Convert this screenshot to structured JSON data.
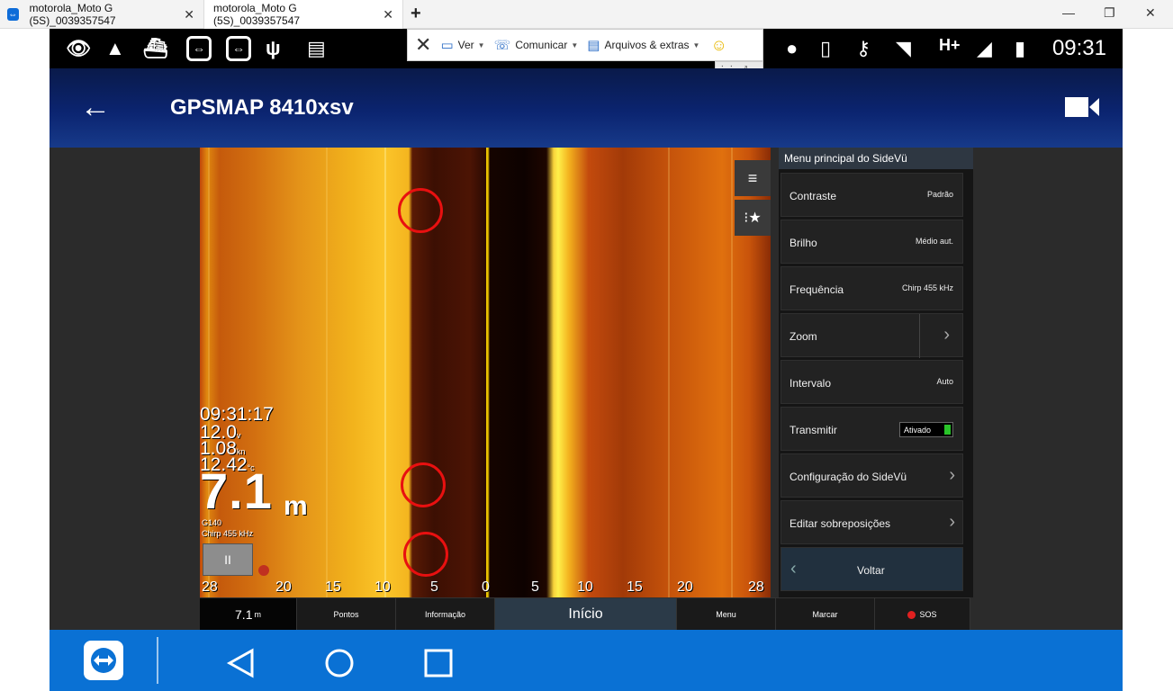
{
  "browser": {
    "tabs": [
      {
        "label": "motorola_Moto G (5S)_0039357547"
      },
      {
        "label": "motorola_Moto G (5S)_0039357547"
      }
    ],
    "new_tab": "+",
    "tab_close": "✕",
    "window_controls": {
      "minimize": "—",
      "maximize": "❐",
      "close": "✕"
    }
  },
  "teamviewer": {
    "close": "✕",
    "ver": "Ver",
    "comunicar": "Comunicar",
    "arquivos": "Arquivos & extras",
    "emoji": "☺"
  },
  "status_bar": {
    "clock": "09:31",
    "network": "H+"
  },
  "app_bar": {
    "title": "GPSMAP 8410xsv"
  },
  "sonar": {
    "time": "09:31:17",
    "voltage": "12.0",
    "voltage_unit": "v",
    "speed": "1.08",
    "speed_unit": "kn",
    "temperature": "12.42",
    "temperature_unit": "°c",
    "depth": "7.1",
    "depth_unit": "m",
    "gain": "G140",
    "frequency": "Chirp 455 kHz",
    "pause": "II",
    "range_ticks": [
      "28",
      "20",
      "15",
      "10",
      "5",
      "0",
      "5",
      "10",
      "15",
      "20",
      "28"
    ]
  },
  "menu": {
    "title": "Menu principal do SideVü",
    "items": [
      {
        "label": "Contraste",
        "value": "Padrão"
      },
      {
        "label": "Brilho",
        "value": "Médio aut."
      },
      {
        "label": "Frequência",
        "value": "Chirp 455 kHz"
      },
      {
        "label": "Zoom",
        "value": ""
      },
      {
        "label": "Intervalo",
        "value": "Auto"
      },
      {
        "label": "Transmitir",
        "value": "Ativado"
      },
      {
        "label": "Configuração do SideVü",
        "value": ""
      },
      {
        "label": "Editar sobreposições",
        "value": ""
      },
      {
        "label": "Voltar",
        "value": ""
      }
    ]
  },
  "plotter_nav": {
    "depth": "7.1",
    "depth_unit": "m",
    "pontos": "Pontos",
    "informacao": "Informação",
    "inicio": "Início",
    "menu": "Menu",
    "marcar": "Marcar",
    "sos": "SOS"
  }
}
